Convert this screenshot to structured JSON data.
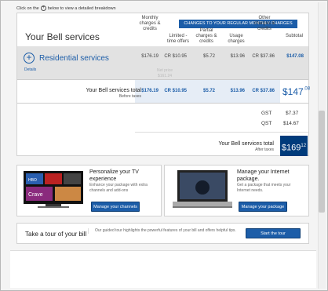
{
  "hint": {
    "before": "Click on the",
    "after": "below to view a detailed breakdown"
  },
  "banner": "CHANGES TO YOUR REGULAR MONTHLY CHARGES",
  "section_title": "Your Bell services",
  "columns": {
    "monthly": "Monthly charges & credits",
    "limited": "Limited - time offers",
    "partial": "Partial charges & credits",
    "usage": "Usage charges",
    "other": "Other charges & credits",
    "subtotal": "Subtotal"
  },
  "residential": {
    "label": "Residential services",
    "details": "Details",
    "monthly": "$176.19",
    "limited": "CR $10.95",
    "partial": "$5.72",
    "usage": "$13.96",
    "other": "CR $37.86",
    "subtotal": "$147.08",
    "net_price_label": "Net price",
    "net_price": "$161.24"
  },
  "total": {
    "label": "Your Bell services total",
    "sublabel": "Before taxes",
    "monthly": "$176.19",
    "limited": "CR $10.95",
    "partial": "$5.72",
    "usage": "$13.96",
    "other": "CR $37.86",
    "subtotal_dollars": "$147",
    "subtotal_cents": ".08"
  },
  "taxes": {
    "gst_label": "GST",
    "gst": "$7.37",
    "qst_label": "QST",
    "qst": "$14.67"
  },
  "final": {
    "label": "Your Bell services total",
    "sublabel": "After taxes",
    "dollars": "$169",
    "cents": "12"
  },
  "promo_tv": {
    "title": "Personalize your TV experience",
    "text": "Enhance your package with extra channels and add-ons",
    "button": "Manage your channels"
  },
  "promo_internet": {
    "title": "Manage your Internet package.",
    "text": "Get a package that meets your Internet needs.",
    "button": "Manage your package"
  },
  "tour": {
    "title": "Take a tour of your bill",
    "text": "Our guided tour highlights the powerful features of your bill and offers helpful tips.",
    "button": "Start the tour"
  }
}
